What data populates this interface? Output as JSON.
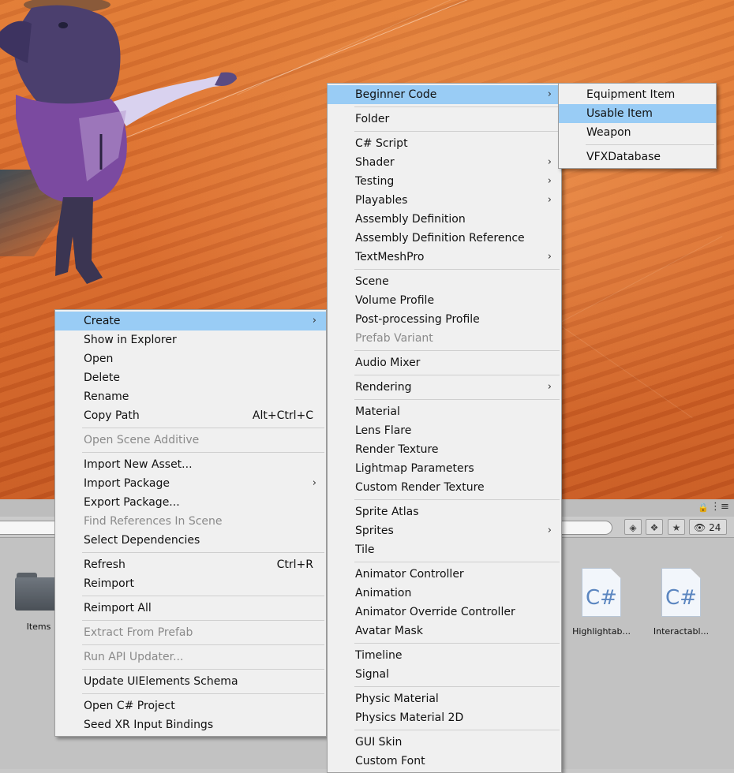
{
  "project_panel": {
    "visibility_count": "24",
    "assets": [
      {
        "name": "Items",
        "type": "folder"
      },
      {
        "name": "Highlightab...",
        "type": "script",
        "icon_text": "C#"
      },
      {
        "name": "Interactabl...",
        "type": "script",
        "icon_text": "C#"
      }
    ]
  },
  "context_menu": {
    "items": [
      {
        "label": "Create",
        "submenu": true,
        "highlight": true
      },
      {
        "label": "Show in Explorer"
      },
      {
        "label": "Open"
      },
      {
        "label": "Delete"
      },
      {
        "label": "Rename"
      },
      {
        "label": "Copy Path",
        "shortcut": "Alt+Ctrl+C"
      },
      {
        "separator": true
      },
      {
        "label": "Open Scene Additive",
        "disabled": true
      },
      {
        "separator": true
      },
      {
        "label": "Import New Asset..."
      },
      {
        "label": "Import Package",
        "submenu": true
      },
      {
        "label": "Export Package..."
      },
      {
        "label": "Find References In Scene",
        "disabled": true
      },
      {
        "label": "Select Dependencies"
      },
      {
        "separator": true
      },
      {
        "label": "Refresh",
        "shortcut": "Ctrl+R"
      },
      {
        "label": "Reimport"
      },
      {
        "separator": true
      },
      {
        "label": "Reimport All"
      },
      {
        "separator": true
      },
      {
        "label": "Extract From Prefab",
        "disabled": true
      },
      {
        "separator": true
      },
      {
        "label": "Run API Updater...",
        "disabled": true
      },
      {
        "separator": true
      },
      {
        "label": "Update UIElements Schema"
      },
      {
        "separator": true
      },
      {
        "label": "Open C# Project"
      },
      {
        "label": "Seed XR Input Bindings"
      }
    ]
  },
  "create_submenu": {
    "items": [
      {
        "label": "Beginner Code",
        "submenu": true,
        "highlight": true
      },
      {
        "separator": true
      },
      {
        "label": "Folder"
      },
      {
        "separator": true
      },
      {
        "label": "C# Script"
      },
      {
        "label": "Shader",
        "submenu": true
      },
      {
        "label": "Testing",
        "submenu": true
      },
      {
        "label": "Playables",
        "submenu": true
      },
      {
        "label": "Assembly Definition"
      },
      {
        "label": "Assembly Definition Reference"
      },
      {
        "label": "TextMeshPro",
        "submenu": true
      },
      {
        "separator": true
      },
      {
        "label": "Scene"
      },
      {
        "label": "Volume Profile"
      },
      {
        "label": "Post-processing Profile"
      },
      {
        "label": "Prefab Variant",
        "disabled": true
      },
      {
        "separator": true
      },
      {
        "label": "Audio Mixer"
      },
      {
        "separator": true
      },
      {
        "label": "Rendering",
        "submenu": true
      },
      {
        "separator": true
      },
      {
        "label": "Material"
      },
      {
        "label": "Lens Flare"
      },
      {
        "label": "Render Texture"
      },
      {
        "label": "Lightmap Parameters"
      },
      {
        "label": "Custom Render Texture"
      },
      {
        "separator": true
      },
      {
        "label": "Sprite Atlas"
      },
      {
        "label": "Sprites",
        "submenu": true
      },
      {
        "label": "Tile"
      },
      {
        "separator": true
      },
      {
        "label": "Animator Controller"
      },
      {
        "label": "Animation"
      },
      {
        "label": "Animator Override Controller"
      },
      {
        "label": "Avatar Mask"
      },
      {
        "separator": true
      },
      {
        "label": "Timeline"
      },
      {
        "label": "Signal"
      },
      {
        "separator": true
      },
      {
        "label": "Physic Material"
      },
      {
        "label": "Physics Material 2D"
      },
      {
        "separator": true
      },
      {
        "label": "GUI Skin"
      },
      {
        "label": "Custom Font"
      }
    ]
  },
  "beginner_code_submenu": {
    "items": [
      {
        "label": "Equipment Item"
      },
      {
        "label": "Usable Item",
        "highlight": true
      },
      {
        "label": "Weapon"
      },
      {
        "separator": true
      },
      {
        "label": "VFXDatabase"
      }
    ]
  },
  "colors": {
    "menu_background": "#f0f0f0",
    "menu_highlight": "#99ccf5",
    "disabled_text": "#8a8a8a",
    "scene_sand": "#d8692c"
  }
}
